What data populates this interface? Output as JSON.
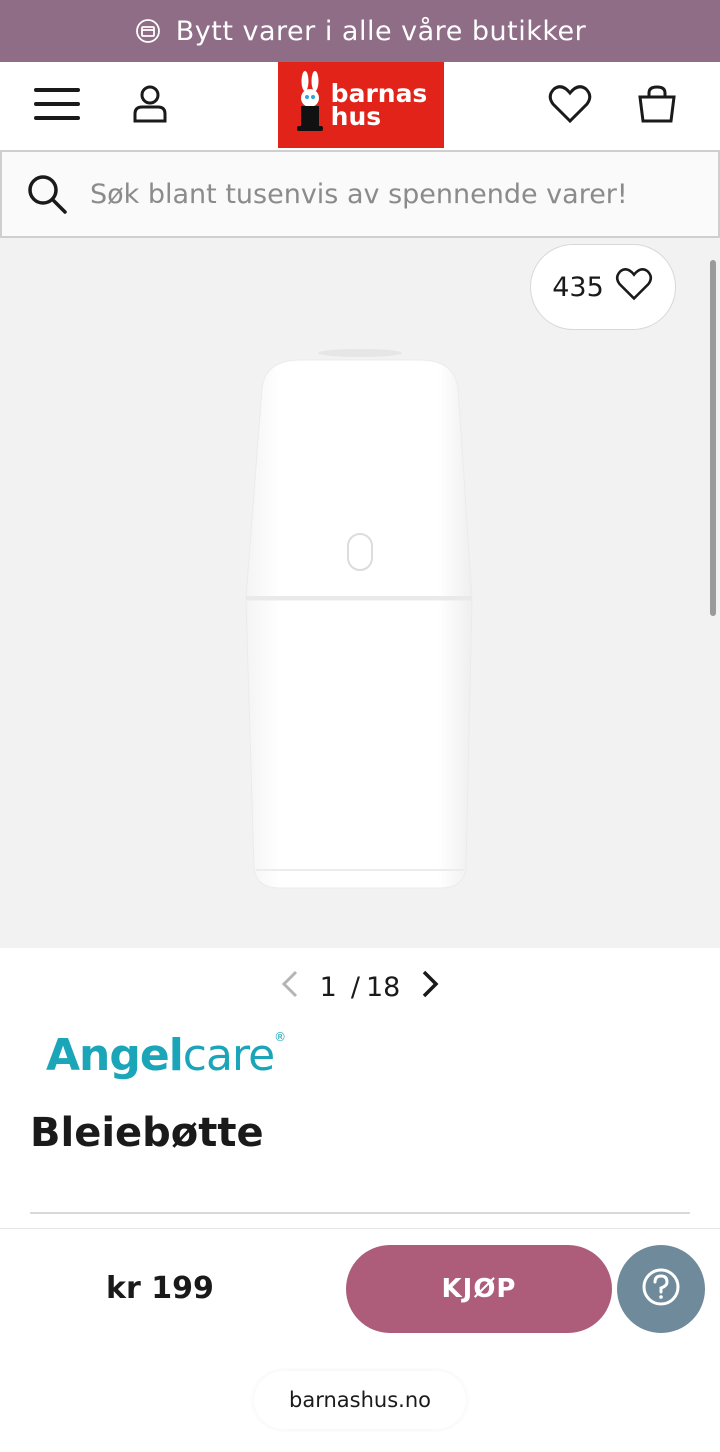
{
  "promo": {
    "text": "Bytt varer i alle våre butikker",
    "icon": "exchange-icon"
  },
  "header": {
    "menu_icon": "hamburger-menu-icon",
    "account_icon": "user-icon",
    "logo_text_line1": "barnas",
    "logo_text_line2": "hus",
    "wishlist_icon": "heart-icon",
    "cart_icon": "shopping-bag-icon"
  },
  "search": {
    "placeholder": "Søk blant tusenvis av spennende varer!",
    "value": ""
  },
  "gallery": {
    "favorite_count": "435",
    "current": "1",
    "separator": "/",
    "total": "18"
  },
  "product": {
    "brand_bold": "Angel",
    "brand_light": "care",
    "brand_mark": "®",
    "title": "Bleiebøtte"
  },
  "buybar": {
    "price": "kr 199",
    "buy_label": "KJØP",
    "help_icon": "question-icon"
  },
  "browser": {
    "url": "barnashus.no"
  },
  "colors": {
    "promo_bg": "#8f6d86",
    "logo_red": "#e2231a",
    "buy_button": "#ad5c7a",
    "help_button": "#6e8a9b",
    "brand_teal": "#1aa6b8"
  }
}
